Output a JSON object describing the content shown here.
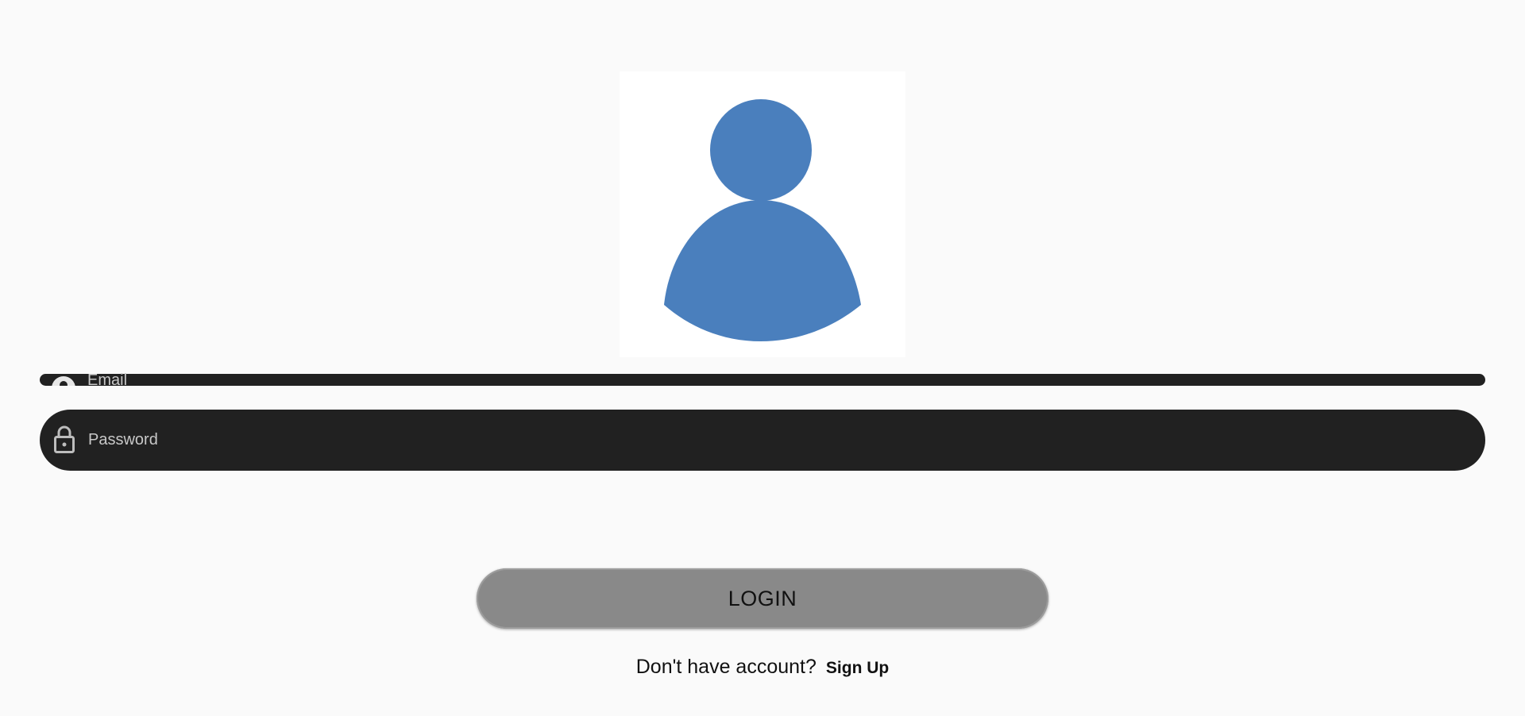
{
  "avatar": {
    "color": "#4a7fbd",
    "icon": "person-icon"
  },
  "form": {
    "email": {
      "placeholder": "Email",
      "icon": "person-circle-icon"
    },
    "password": {
      "placeholder": "Password",
      "icon": "lock-icon"
    },
    "field_background": "#212121",
    "placeholder_color": "#c8c8c8"
  },
  "login_button": {
    "label": "LOGIN",
    "background": "#898989"
  },
  "signup": {
    "prompt": "Don't have account?",
    "link_label": "Sign Up"
  }
}
